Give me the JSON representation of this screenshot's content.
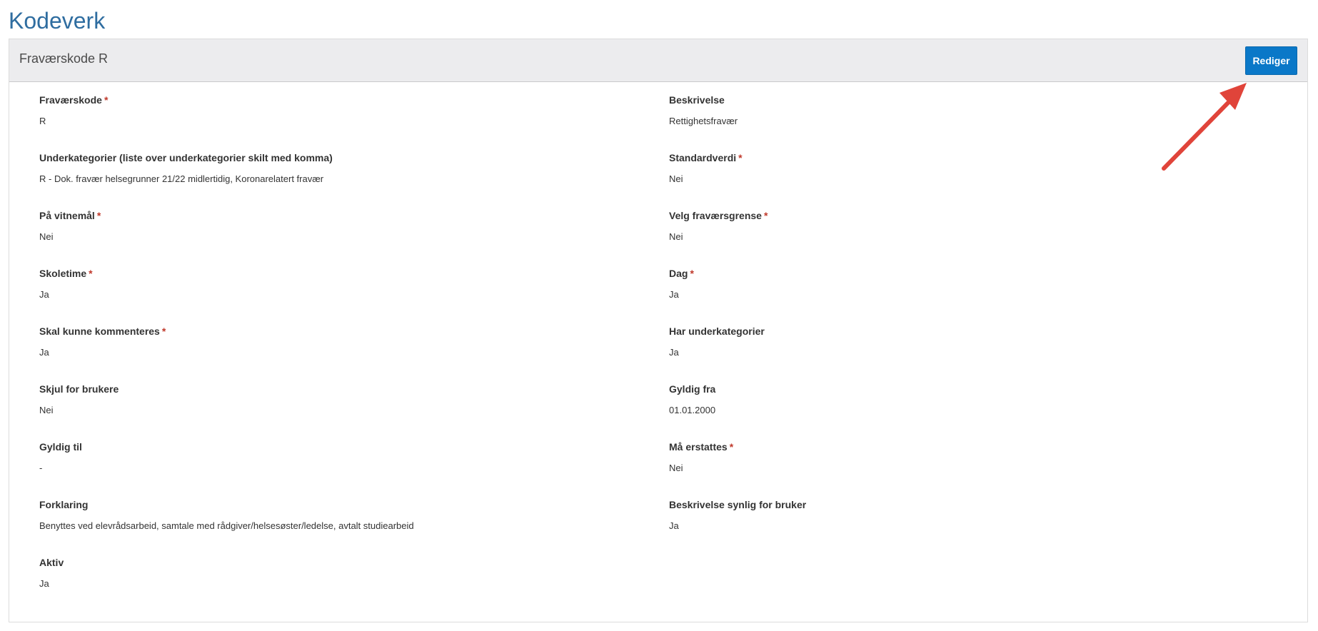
{
  "page": {
    "title": "Kodeverk"
  },
  "panel": {
    "title": "Fraværskode R",
    "edit_button_label": "Rediger"
  },
  "required_marker": "*",
  "fields": {
    "left": [
      {
        "label": "Fraværskode",
        "required": true,
        "value": "R"
      },
      {
        "label": "Underkategorier (liste over underkategorier skilt med komma)",
        "required": false,
        "value": "R - Dok. fravær helsegrunner 21/22 midlertidig, Koronarelatert fravær"
      },
      {
        "label": "På vitnemål",
        "required": true,
        "value": "Nei"
      },
      {
        "label": "Skoletime",
        "required": true,
        "value": "Ja"
      },
      {
        "label": "Skal kunne kommenteres",
        "required": true,
        "value": "Ja"
      },
      {
        "label": "Skjul for brukere",
        "required": false,
        "value": "Nei"
      },
      {
        "label": "Gyldig til",
        "required": false,
        "value": "-"
      },
      {
        "label": "Forklaring",
        "required": false,
        "value": "Benyttes ved elevrådsarbeid, samtale med rådgiver/helsesøster/ledelse, avtalt studiearbeid"
      },
      {
        "label": "Aktiv",
        "required": false,
        "value": "Ja"
      }
    ],
    "right": [
      {
        "label": "Beskrivelse",
        "required": false,
        "value": "Rettighetsfravær"
      },
      {
        "label": "Standardverdi",
        "required": true,
        "value": "Nei"
      },
      {
        "label": "Velg fraværsgrense",
        "required": true,
        "value": "Nei"
      },
      {
        "label": "Dag",
        "required": true,
        "value": "Ja"
      },
      {
        "label": "Har underkategorier",
        "required": false,
        "value": "Ja"
      },
      {
        "label": "Gyldig fra",
        "required": false,
        "value": "01.01.2000"
      },
      {
        "label": "Må erstattes",
        "required": true,
        "value": "Nei"
      },
      {
        "label": "Beskrivelse synlig for bruker",
        "required": false,
        "value": "Ja"
      }
    ]
  },
  "colors": {
    "title": "#2f6da0",
    "button": "#0a78c8",
    "required": "#c0392b",
    "annotation_arrow": "#e0443a"
  },
  "annotation": {
    "icon": "red-arrow-icon"
  }
}
